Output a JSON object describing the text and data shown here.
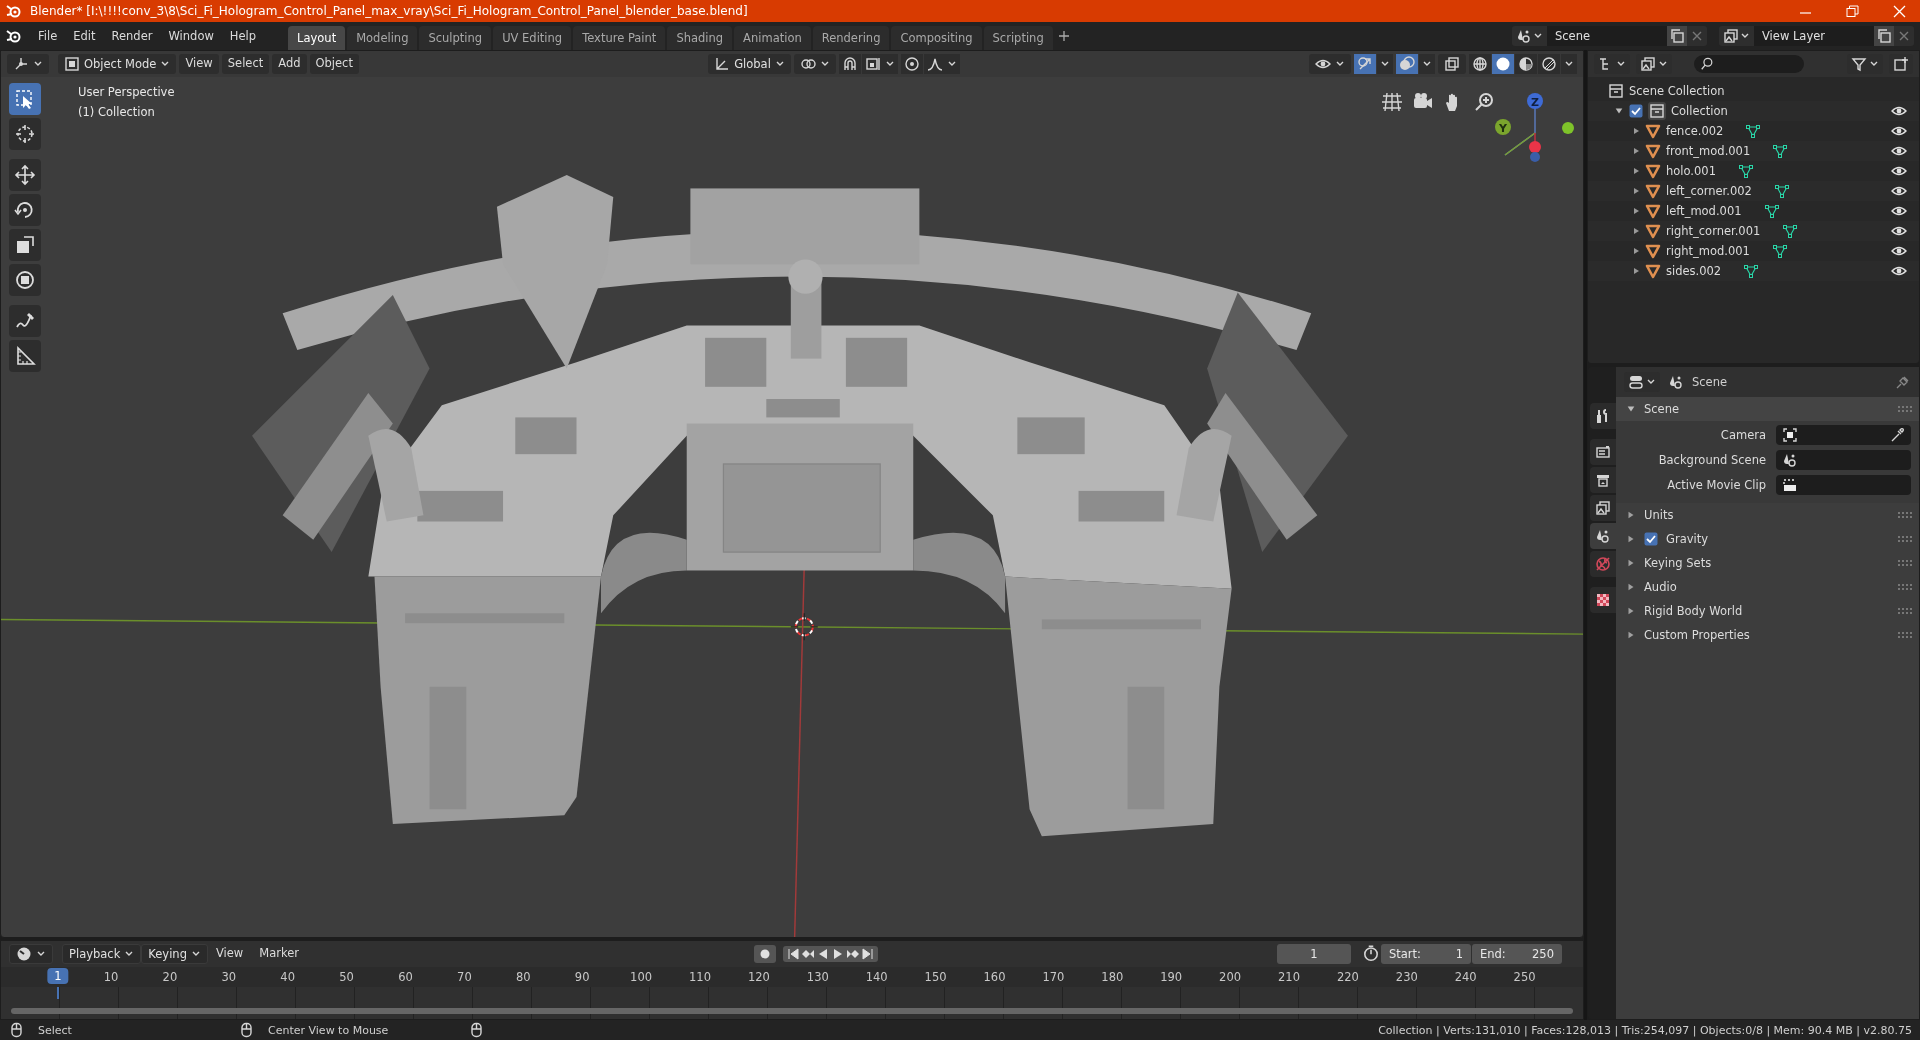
{
  "window": {
    "title": "Blender* [I:\\!!!!conv_3\\8\\Sci_Fi_Hologram_Control_Panel_max_vray\\Sci_Fi_Hologram_Control_Panel_blender_base.blend]"
  },
  "menu": [
    "File",
    "Edit",
    "Render",
    "Window",
    "Help"
  ],
  "workspaces": [
    {
      "label": "Layout",
      "selected": true
    },
    {
      "label": "Modeling",
      "selected": false
    },
    {
      "label": "Sculpting",
      "selected": false
    },
    {
      "label": "UV Editing",
      "selected": false
    },
    {
      "label": "Texture Paint",
      "selected": false
    },
    {
      "label": "Shading",
      "selected": false
    },
    {
      "label": "Animation",
      "selected": false
    },
    {
      "label": "Rendering",
      "selected": false
    },
    {
      "label": "Compositing",
      "selected": false
    },
    {
      "label": "Scripting",
      "selected": false
    }
  ],
  "scene_selector": {
    "value": "Scene"
  },
  "view_layer_selector": {
    "value": "View Layer"
  },
  "viewport": {
    "mode": "Object Mode",
    "menus": [
      "View",
      "Select",
      "Add",
      "Object"
    ],
    "orientation": "Global",
    "perspective": "User Perspective",
    "collection": "(1) Collection",
    "tools": [
      {
        "kind": "select",
        "selected": true
      },
      {
        "kind": "cursor",
        "selected": false
      },
      {
        "kind": "move",
        "selected": false
      },
      {
        "kind": "rotate",
        "selected": false
      },
      {
        "kind": "scale",
        "selected": false
      },
      {
        "kind": "transform",
        "selected": false
      },
      {
        "kind": "annotate",
        "selected": false
      },
      {
        "kind": "measure",
        "selected": false
      }
    ],
    "gizmo": {
      "z": "Z",
      "y": "Y"
    },
    "shading": [
      {
        "kind": "wireframe",
        "selected": false
      },
      {
        "kind": "solid",
        "selected": true
      },
      {
        "kind": "material",
        "selected": false
      },
      {
        "kind": "rendered",
        "selected": false
      }
    ]
  },
  "outliner": {
    "root": "Scene Collection",
    "collection": {
      "name": "Collection",
      "checked": true,
      "expanded": true,
      "children": [
        {
          "name": "fence.002"
        },
        {
          "name": "front_mod.001"
        },
        {
          "name": "holo.001"
        },
        {
          "name": "left_corner.002"
        },
        {
          "name": "left_mod.001"
        },
        {
          "name": "right_corner.001"
        },
        {
          "name": "right_mod.001"
        },
        {
          "name": "sides.002"
        }
      ]
    }
  },
  "properties": {
    "context": "Scene",
    "tabs": [
      {
        "kind": "tool",
        "selected": false
      },
      {
        "kind": "render",
        "selected": false
      },
      {
        "kind": "output",
        "selected": false
      },
      {
        "kind": "view_layer",
        "selected": false
      },
      {
        "kind": "scene",
        "selected": true
      },
      {
        "kind": "world",
        "selected": false
      },
      {
        "kind": "texture",
        "selected": false
      }
    ],
    "panels": [
      {
        "title": "Scene",
        "expanded": true,
        "fields": [
          {
            "label": "Camera",
            "kind": "camera"
          },
          {
            "label": "Background Scene",
            "kind": "scene"
          },
          {
            "label": "Active Movie Clip",
            "kind": "clip"
          }
        ]
      },
      {
        "title": "Units",
        "expanded": false
      },
      {
        "title": "Gravity",
        "expanded": false,
        "checked": true
      },
      {
        "title": "Keying Sets",
        "expanded": false
      },
      {
        "title": "Audio",
        "expanded": false
      },
      {
        "title": "Rigid Body World",
        "expanded": false
      },
      {
        "title": "Custom Properties",
        "expanded": false
      }
    ]
  },
  "timeline": {
    "menus": [
      {
        "label": "Playback",
        "kind": "dropdown"
      },
      {
        "label": "Keying",
        "kind": "dropdown"
      },
      {
        "label": "View",
        "kind": "menu"
      },
      {
        "label": "Marker",
        "kind": "menu"
      }
    ],
    "current_frame": "1",
    "start_label": "Start:",
    "start": "1",
    "end_label": "End:",
    "end": "250",
    "playhead": "1",
    "ticks": [
      "10",
      "20",
      "30",
      "40",
      "50",
      "60",
      "70",
      "80",
      "90",
      "100",
      "110",
      "120",
      "130",
      "140",
      "150",
      "160",
      "170",
      "180",
      "190",
      "200",
      "210",
      "220",
      "230",
      "240",
      "250"
    ]
  },
  "status_bar": {
    "hints": [
      "Select",
      "Center View to Mouse"
    ],
    "stats": "Collection | Verts:131,010 | Faces:128,013 | Tris:254,097 | Objects:0/8 | Mem: 90.4 MB | v2.80.75"
  }
}
